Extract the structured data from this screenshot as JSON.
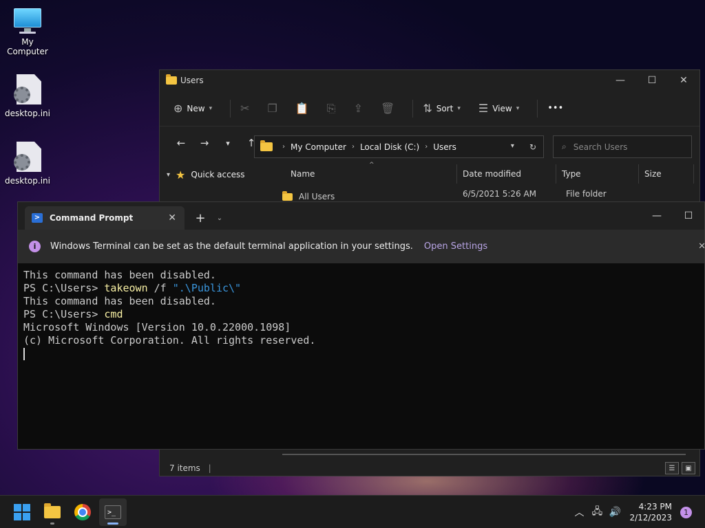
{
  "desktop": {
    "icons": [
      {
        "label": "My Computer",
        "icon": "monitor-icon"
      },
      {
        "label": "desktop.ini",
        "icon": "settings-file-icon"
      },
      {
        "label": "desktop.ini",
        "icon": "settings-file-icon"
      }
    ]
  },
  "explorer": {
    "title": "Users",
    "toolbar": {
      "new_label": "New",
      "sort_label": "Sort",
      "view_label": "View",
      "more_label": "•••"
    },
    "breadcrumb": [
      "My Computer",
      "Local Disk (C:)",
      "Users"
    ],
    "search_placeholder": "Search Users",
    "nav": {
      "quick_access": "Quick access"
    },
    "columns": [
      "Name",
      "Date modified",
      "Type",
      "Size"
    ],
    "rows": [
      {
        "name": "All Users",
        "date": "6/5/2021 5:26 AM",
        "type": "File folder",
        "size": ""
      }
    ],
    "status": "7 items"
  },
  "terminal": {
    "tab_title": "Command Prompt",
    "info_message": "Windows Terminal can be set as the default terminal application in your settings.",
    "info_link": "Open Settings",
    "lines": {
      "l1": "This command has been disabled.",
      "l2_prompt": "PS C:\\Users> ",
      "l2_cmd": "takeown",
      "l2_arg": " /f ",
      "l2_str": "\".\\Public\\\"",
      "l3": "This command has been disabled.",
      "l4_prompt": "PS C:\\Users> ",
      "l4_cmd": "cmd",
      "l5": "Microsoft Windows [Version 10.0.22000.1098]",
      "l6": "(c) Microsoft Corporation. All rights reserved."
    }
  },
  "taskbar": {
    "time": "4:23 PM",
    "date": "2/12/2023",
    "notification_count": "1"
  }
}
